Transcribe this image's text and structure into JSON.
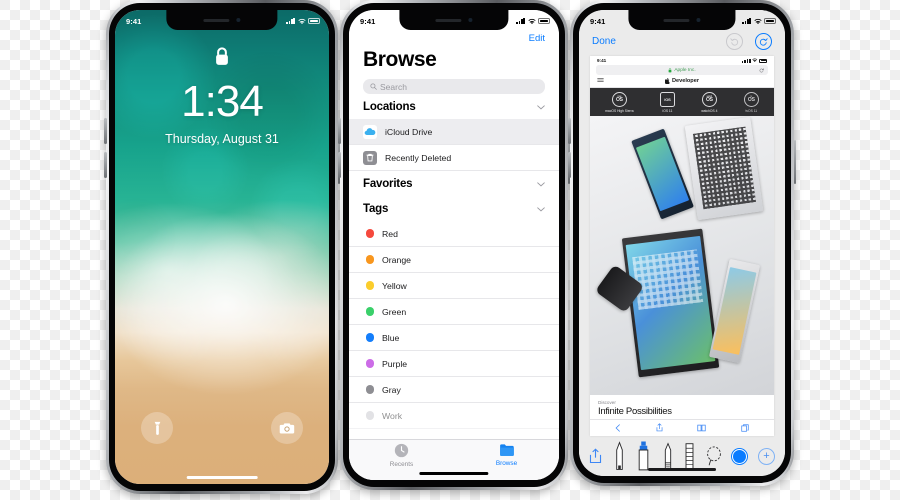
{
  "phones": [
    {
      "id": "lockscreen",
      "status": {
        "time": "9:41",
        "signal_icon": "cellular-bars-icon",
        "wifi_icon": "wifi-icon",
        "battery_icon": "battery-icon"
      },
      "lock_icon": "lock-icon",
      "clock": "1:34",
      "date": "Thursday, August 31",
      "quick_left": {
        "label": "Flashlight",
        "icon": "flashlight-icon"
      },
      "quick_right": {
        "label": "Camera",
        "icon": "camera-icon"
      },
      "wallpaper_colors": {
        "top": "#0c6a67",
        "mid": "#27b394",
        "foam": "#f0e0c8",
        "sand": "#dcaf79"
      }
    },
    {
      "id": "files-browse",
      "status": {
        "time": "9:41",
        "signal_icon": "cellular-bars-icon",
        "wifi_icon": "wifi-icon",
        "battery_icon": "battery-icon"
      },
      "edit_label": "Edit",
      "title": "Browse",
      "search": {
        "placeholder": "Search",
        "icon": "search-icon"
      },
      "sections": [
        {
          "header": "Locations",
          "chevron_icon": "chevron-down-icon",
          "rows": [
            {
              "label": "iCloud Drive",
              "icon": "icloud-icon",
              "selected": true
            },
            {
              "label": "Recently Deleted",
              "icon": "trash-icon",
              "selected": false
            }
          ]
        },
        {
          "header": "Favorites",
          "chevron_icon": "chevron-down-icon",
          "rows": []
        },
        {
          "header": "Tags",
          "chevron_icon": "chevron-down-icon",
          "rows": [
            {
              "label": "Red",
              "color": "#f5493d"
            },
            {
              "label": "Orange",
              "color": "#f8961e"
            },
            {
              "label": "Yellow",
              "color": "#fbcd2c"
            },
            {
              "label": "Green",
              "color": "#3ad06a"
            },
            {
              "label": "Blue",
              "color": "#147efb"
            },
            {
              "label": "Purple",
              "color": "#cc6ce7"
            },
            {
              "label": "Gray",
              "color": "#8e8e93"
            },
            {
              "label": "Work",
              "color": "#c7c7cc"
            }
          ]
        }
      ],
      "tabs": [
        {
          "label": "Recents",
          "icon": "clock-icon",
          "active": false,
          "color": "#8e8e93"
        },
        {
          "label": "Browse",
          "icon": "folder-icon",
          "active": true,
          "color": "#0a7cff"
        }
      ]
    },
    {
      "id": "markup-screenshot",
      "status": {
        "time": "9:41",
        "signal_icon": "cellular-bars-icon",
        "wifi_icon": "wifi-icon",
        "battery_icon": "battery-icon"
      },
      "done_label": "Done",
      "undo_icon": "undo-circle-icon",
      "redo_icon": "redo-circle-icon",
      "preview": {
        "status_time": "9:41",
        "url_text": "Apple Inc.",
        "lock_icon": "lock-small-icon",
        "reload_icon": "reload-icon",
        "nav_title": "Developer",
        "apple_logo_icon": "apple-logo-icon",
        "menu_icon": "hamburger-icon",
        "os_items": [
          {
            "kicker": "mac",
            "mark": "OS",
            "label": "macOS High Sierra",
            "square": false
          },
          {
            "kicker": "",
            "mark": "iOS",
            "label": "iOS 11",
            "square": true
          },
          {
            "kicker": "watch",
            "mark": "OS",
            "label": "watchOS 4",
            "square": false
          },
          {
            "kicker": "tv",
            "mark": "OS",
            "label": "tvOS 11",
            "square": false
          }
        ],
        "discover_kicker": "Discover",
        "discover_title": "Infinite Possibilities",
        "toolbar_icons": [
          "back-icon",
          "share-icon",
          "bookmarks-icon",
          "tabs-icon"
        ]
      },
      "tools": [
        {
          "name": "share-icon",
          "label": "Share"
        },
        {
          "name": "pen-tool-icon",
          "label": "Pen"
        },
        {
          "name": "marker-tool-icon",
          "label": "Highlighter"
        },
        {
          "name": "pencil-tool-icon",
          "label": "Pencil"
        },
        {
          "name": "eraser-tool-icon",
          "label": "Eraser"
        },
        {
          "name": "lasso-tool-icon",
          "label": "Lasso"
        },
        {
          "name": "color-swatch",
          "label": "Blue"
        },
        {
          "name": "add-icon",
          "label": "Add"
        }
      ],
      "accent_color": "#0a7cff"
    }
  ]
}
